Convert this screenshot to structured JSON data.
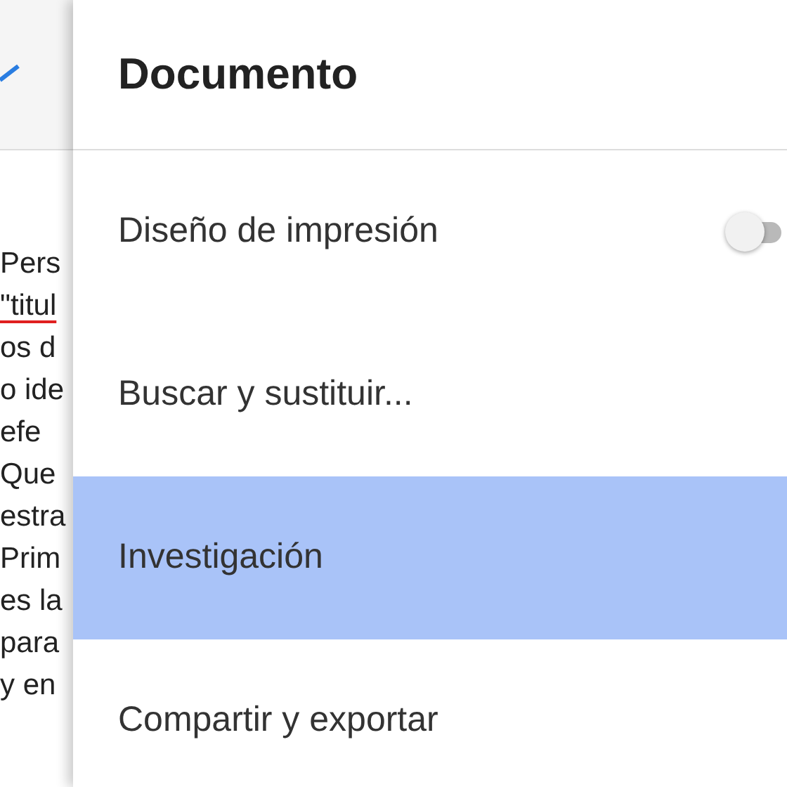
{
  "document_lines": [
    {
      "text": "Pers",
      "misspelled": false
    },
    {
      "text": "\"titul",
      "misspelled": true
    },
    {
      "text": "os d",
      "misspelled": false
    },
    {
      "text": "o ide",
      "misspelled": false
    },
    {
      "text": "efe",
      "misspelled": false
    },
    {
      "text": "Que",
      "misspelled": false
    },
    {
      "text": "estra",
      "misspelled": false
    },
    {
      "text": "Prim",
      "misspelled": false
    },
    {
      "text": "es la",
      "misspelled": false
    },
    {
      "text": "para",
      "misspelled": false
    },
    {
      "text": "y en",
      "misspelled": false
    }
  ],
  "menu": {
    "title": "Documento",
    "items": [
      {
        "label": "Diseño de impresión",
        "kind": "toggle",
        "on": false,
        "selected": false
      },
      {
        "label": "Buscar y sustituir...",
        "kind": "action",
        "selected": false
      },
      {
        "label": "Investigación",
        "kind": "action",
        "selected": true
      },
      {
        "label": "Compartir y exportar",
        "kind": "action",
        "selected": false
      }
    ]
  }
}
